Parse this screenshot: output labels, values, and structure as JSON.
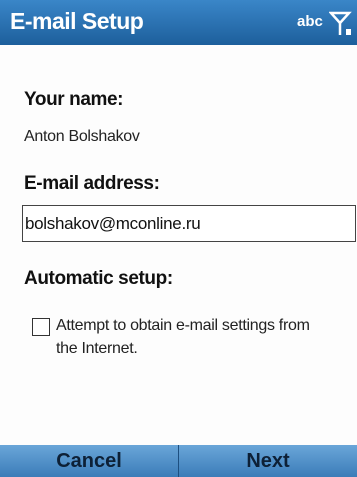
{
  "titlebar": {
    "title": "E-mail Setup",
    "input_mode": "abc",
    "signal_icon": "signal-antenna-icon",
    "background": "#2a72b5"
  },
  "form": {
    "name_label": "Your name:",
    "name_value": "Anton Bolshakov",
    "email_label": "E-mail address:",
    "email_value": "bolshakov@mconline.ru",
    "auto_setup_label": "Automatic setup:",
    "auto_setup_checkbox": {
      "label": "Attempt to obtain e-mail settings from the Internet.",
      "checked": false
    }
  },
  "softkeys": {
    "left_label": "Cancel",
    "right_label": "Next",
    "background": "#5a98d0"
  }
}
